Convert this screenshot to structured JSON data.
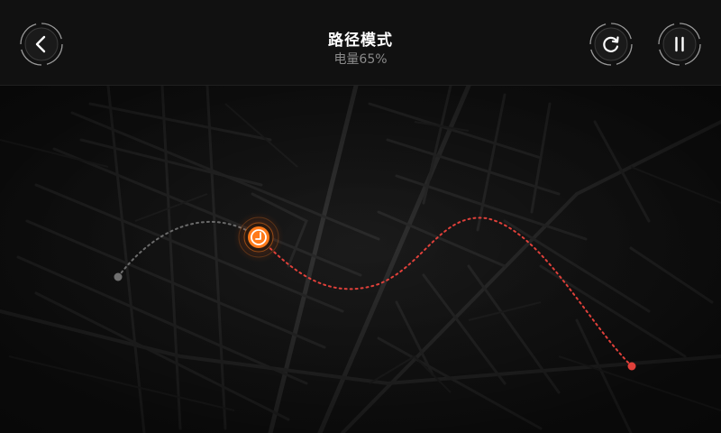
{
  "header": {
    "title": "路径模式",
    "battery_text": "电量65%"
  },
  "controls": {
    "back_icon": "chevron-left-icon",
    "reset_icon": "refresh-icon",
    "pause_icon": "pause-icon"
  },
  "route": {
    "progress_fraction": 0.25
  },
  "colors": {
    "header_bg": "#111111",
    "map_bg": "#151515",
    "street": "#2a2a2a",
    "travelled_path": "#6b6b6b",
    "planned_path": "#e0403a",
    "marker_accent": "#ff7a1a",
    "text_primary": "#ffffff",
    "text_secondary": "#8a8a8a"
  }
}
